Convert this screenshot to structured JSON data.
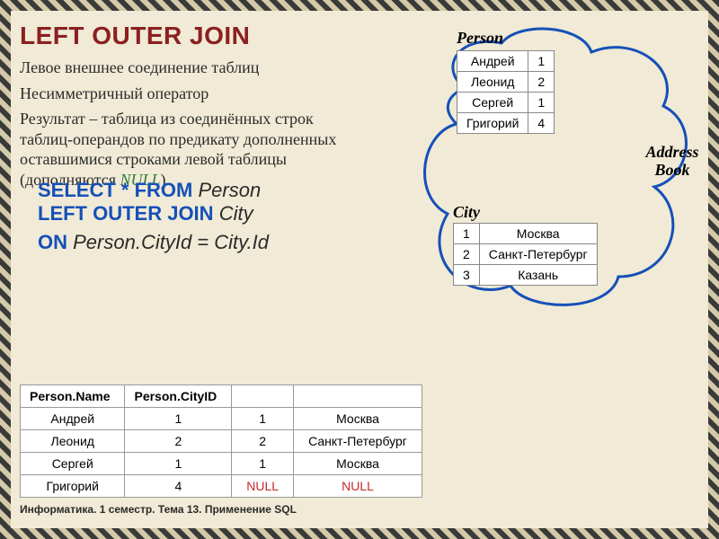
{
  "title": "LEFT OUTER  JOIN",
  "desc": {
    "l1": "Левое внешнее соединение таблиц",
    "l2": "Несимметричный оператор",
    "l3a": "Результат – таблица из соединённых строк таблиц-операндов по предикату дополненных оставшимися строками левой таблицы (дополняются ",
    "null": "NULL",
    "l3b": ")"
  },
  "sql": {
    "l1a": "SELECT * FROM",
    "l1b": "Person",
    "l2a": "LEFT OUTER JOIN",
    "l2b": "City",
    "l3a": "ON",
    "l3b": "Person.CityId = City.Id"
  },
  "labels": {
    "person": "Person",
    "city": "City",
    "addressBook": "Address Book"
  },
  "person": [
    {
      "name": "Андрей",
      "id": "1"
    },
    {
      "name": "Леонид",
      "id": "2"
    },
    {
      "name": "Сергей",
      "id": "1"
    },
    {
      "name": "Григорий",
      "id": "4"
    }
  ],
  "city": [
    {
      "id": "1",
      "name": "Москва"
    },
    {
      "id": "2",
      "name": "Санкт-Петербург"
    },
    {
      "id": "3",
      "name": "Казань"
    }
  ],
  "result": {
    "headers": [
      "Person.Name",
      "Person.CityID",
      "",
      ""
    ],
    "rows": [
      [
        "Андрей",
        "1",
        "1",
        "Москва"
      ],
      [
        "Леонид",
        "2",
        "2",
        "Санкт-Петербург"
      ],
      [
        "Сергей",
        "1",
        "1",
        "Москва"
      ],
      [
        "Григорий",
        "4",
        "NULL",
        "NULL"
      ]
    ]
  },
  "footer": "Информатика. 1 семестр. Тема 13. Применение SQL"
}
